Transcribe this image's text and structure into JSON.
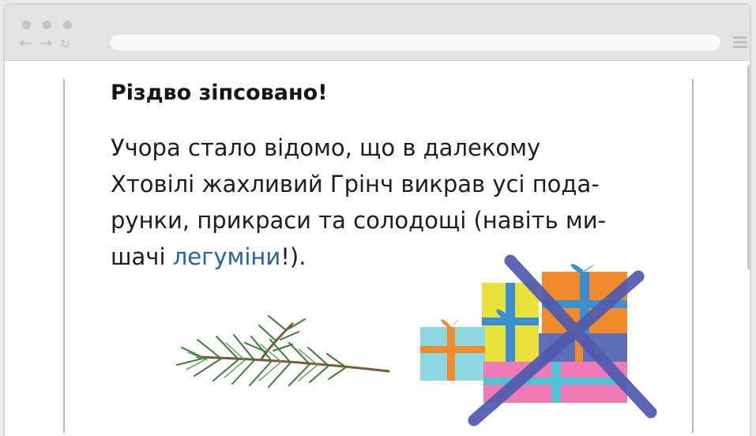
{
  "browser": {
    "window_dots": [
      "close",
      "minimize",
      "maximize"
    ],
    "back_icon": "←",
    "forward_icon": "→",
    "reload_icon": "↻",
    "address": ""
  },
  "article": {
    "title": "Різдво зіпсовано!",
    "lines": [
      "Учора стало відомо, що в далекому",
      "Хтовілі жахливий Грінч викрав усі пода-",
      "рунки, прикраси та солодощі (навіть ми-"
    ],
    "last_line_before": "шачі ",
    "link_text": "легуміни",
    "last_line_after": "!)."
  },
  "colors": {
    "link": "#2463a6",
    "cross": "#4e5bb0",
    "chrome": "#e2e3e5",
    "frame_border": "#b9babc"
  },
  "images": {
    "branch": "fir-branch-image",
    "gifts": "crossed-out-gift-boxes-image"
  }
}
